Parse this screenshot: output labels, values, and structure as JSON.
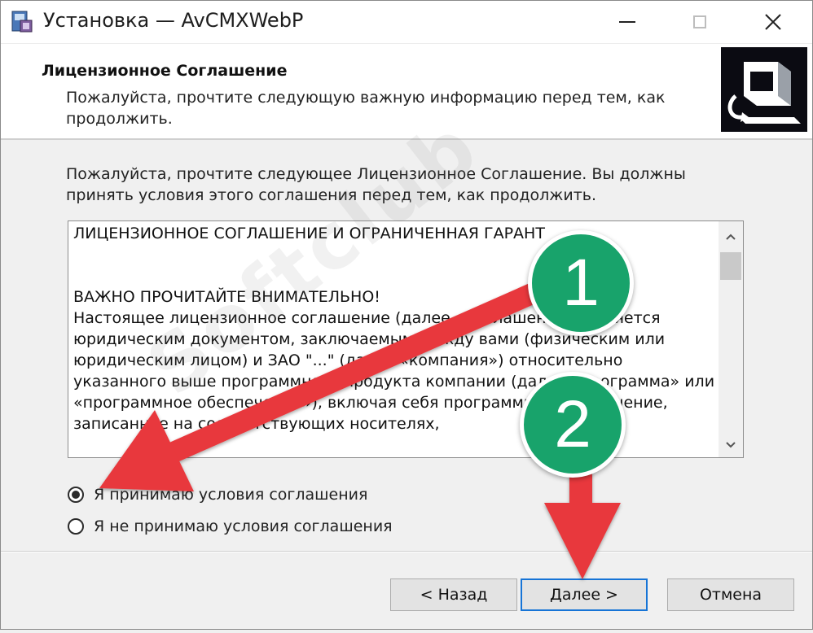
{
  "window": {
    "title": "Установка — AvCMXWebP",
    "icons": {
      "app": "installer-icon",
      "minimize": "minimize-icon",
      "maximize": "maximize-icon",
      "close": "close-icon"
    }
  },
  "header": {
    "title": "Лицензионное Соглашение",
    "description": "Пожалуйста, прочтите следующую важную информацию перед тем, как продолжить.",
    "image_icon": "setup-computer-icon"
  },
  "body": {
    "intro": "Пожалуйста, прочтите следующее Лицензионное Соглашение. Вы должны принять условия этого соглашения перед тем, как продолжить.",
    "license_text": "ЛИЦЕНЗИОННОЕ СОГЛАШЕНИЕ И ОГРАНИЧЕННАЯ ГАРАНТ\n\n\nВАЖНО  ПРОЧИТАЙТЕ ВНИМАТЕЛЬНО!\nНастоящее лицензионное соглашение (далее «Соглашение») является юридическим документом, заключаемым между вами (физическим или юридическим лицом) и ЗАО \"...\" (далее «компания») относительно указанного выше программного продукта компании (далее «программа» или «программное обеспечение»), включая себя программное обеспечение, записанное на соответствующих носителях,",
    "scroll_up_icon": "chevron-up-icon",
    "scroll_down_icon": "chevron-down-icon"
  },
  "options": {
    "accept_label": "Я принимаю условия соглашения",
    "decline_label": "Я не принимаю условия соглашения",
    "selected": "accept"
  },
  "buttons": {
    "back": "< Назад",
    "next": "Далее >",
    "cancel": "Отмена"
  },
  "annotations": {
    "step1": "1",
    "step2": "2",
    "color": "#18a36b",
    "arrow_color": "#e8393c"
  },
  "watermark": "Softclub"
}
